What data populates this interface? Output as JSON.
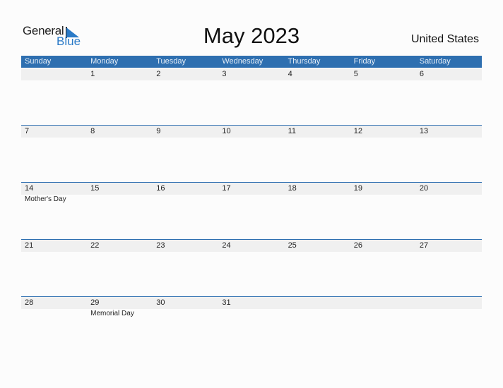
{
  "logo": {
    "general": "General",
    "blue": "Blue"
  },
  "title": "May 2023",
  "country": "United States",
  "colors": {
    "accent": "#2e6fb0",
    "row_band": "#f0f0f0"
  },
  "weekdays": [
    "Sunday",
    "Monday",
    "Tuesday",
    "Wednesday",
    "Thursday",
    "Friday",
    "Saturday"
  ],
  "weeks": [
    {
      "days": [
        {
          "num": "",
          "holiday": ""
        },
        {
          "num": "1",
          "holiday": ""
        },
        {
          "num": "2",
          "holiday": ""
        },
        {
          "num": "3",
          "holiday": ""
        },
        {
          "num": "4",
          "holiday": ""
        },
        {
          "num": "5",
          "holiday": ""
        },
        {
          "num": "6",
          "holiday": ""
        }
      ]
    },
    {
      "days": [
        {
          "num": "7",
          "holiday": ""
        },
        {
          "num": "8",
          "holiday": ""
        },
        {
          "num": "9",
          "holiday": ""
        },
        {
          "num": "10",
          "holiday": ""
        },
        {
          "num": "11",
          "holiday": ""
        },
        {
          "num": "12",
          "holiday": ""
        },
        {
          "num": "13",
          "holiday": ""
        }
      ]
    },
    {
      "days": [
        {
          "num": "14",
          "holiday": "Mother's Day"
        },
        {
          "num": "15",
          "holiday": ""
        },
        {
          "num": "16",
          "holiday": ""
        },
        {
          "num": "17",
          "holiday": ""
        },
        {
          "num": "18",
          "holiday": ""
        },
        {
          "num": "19",
          "holiday": ""
        },
        {
          "num": "20",
          "holiday": ""
        }
      ]
    },
    {
      "days": [
        {
          "num": "21",
          "holiday": ""
        },
        {
          "num": "22",
          "holiday": ""
        },
        {
          "num": "23",
          "holiday": ""
        },
        {
          "num": "24",
          "holiday": ""
        },
        {
          "num": "25",
          "holiday": ""
        },
        {
          "num": "26",
          "holiday": ""
        },
        {
          "num": "27",
          "holiday": ""
        }
      ]
    },
    {
      "days": [
        {
          "num": "28",
          "holiday": ""
        },
        {
          "num": "29",
          "holiday": "Memorial Day"
        },
        {
          "num": "30",
          "holiday": ""
        },
        {
          "num": "31",
          "holiday": ""
        },
        {
          "num": "",
          "holiday": ""
        },
        {
          "num": "",
          "holiday": ""
        },
        {
          "num": "",
          "holiday": ""
        }
      ]
    }
  ]
}
